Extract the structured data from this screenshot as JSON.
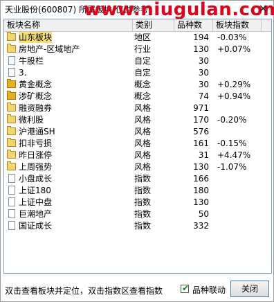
{
  "window": {
    "title": "天业股份(600807)   所属板块(仅供参考",
    "watermark": "www.niugulan.com",
    "close_glyph": "✕"
  },
  "table": {
    "headers": [
      "板块名称",
      "类别",
      "品种数",
      "板块指数"
    ],
    "rows": [
      {
        "icon": "folder",
        "name": "山东板块",
        "type": "地区",
        "count": "194",
        "index": "-0.03%",
        "selected": true
      },
      {
        "icon": "folder",
        "name": "房地产-区域地产",
        "type": "行业",
        "count": "130",
        "index": "+0.07%"
      },
      {
        "icon": "doc",
        "name": "牛股栏",
        "type": "自定",
        "count": "30",
        "index": ""
      },
      {
        "icon": "doc-gray",
        "name": "3.",
        "type": "自定",
        "count": "30",
        "index": ""
      },
      {
        "icon": "folder-gold",
        "name": "黄金概念",
        "type": "概念",
        "count": "30",
        "index": "+0.29%"
      },
      {
        "icon": "folder-gold",
        "name": "涉矿概念",
        "type": "概念",
        "count": "74",
        "index": "+0.94%"
      },
      {
        "icon": "folder",
        "name": "融资融券",
        "type": "风格",
        "count": "971",
        "index": ""
      },
      {
        "icon": "folder",
        "name": "微利股",
        "type": "风格",
        "count": "170",
        "index": "-0.20%"
      },
      {
        "icon": "folder",
        "name": "沪港通SH",
        "type": "风格",
        "count": "576",
        "index": ""
      },
      {
        "icon": "folder",
        "name": "扣非亏损",
        "type": "风格",
        "count": "161",
        "index": "-0.15%"
      },
      {
        "icon": "folder",
        "name": "昨日涨停",
        "type": "风格",
        "count": "31",
        "index": "+4.47%"
      },
      {
        "icon": "folder",
        "name": "上周强势",
        "type": "风格",
        "count": "130",
        "index": "-1.07%"
      },
      {
        "icon": "doc-gray",
        "name": "小盘成长",
        "type": "指数",
        "count": "166",
        "index": ""
      },
      {
        "icon": "doc-gray",
        "name": "上证180",
        "type": "指数",
        "count": "180",
        "index": ""
      },
      {
        "icon": "doc-gray",
        "name": "上证中盘",
        "type": "指数",
        "count": "130",
        "index": ""
      },
      {
        "icon": "doc-gray",
        "name": "巨潮地产",
        "type": "指数",
        "count": "50",
        "index": ""
      },
      {
        "icon": "doc-gray",
        "name": "国证成长",
        "type": "指数",
        "count": "332",
        "index": ""
      }
    ]
  },
  "status": {
    "hint": "双击查看板块并定位，双击指数区查看指数",
    "checkbox_label": "品种联动",
    "checkbox_checked": true,
    "close_button": "关闭"
  },
  "colors": {
    "selected_row": "#f5e07a",
    "watermark": "#e0001b"
  }
}
